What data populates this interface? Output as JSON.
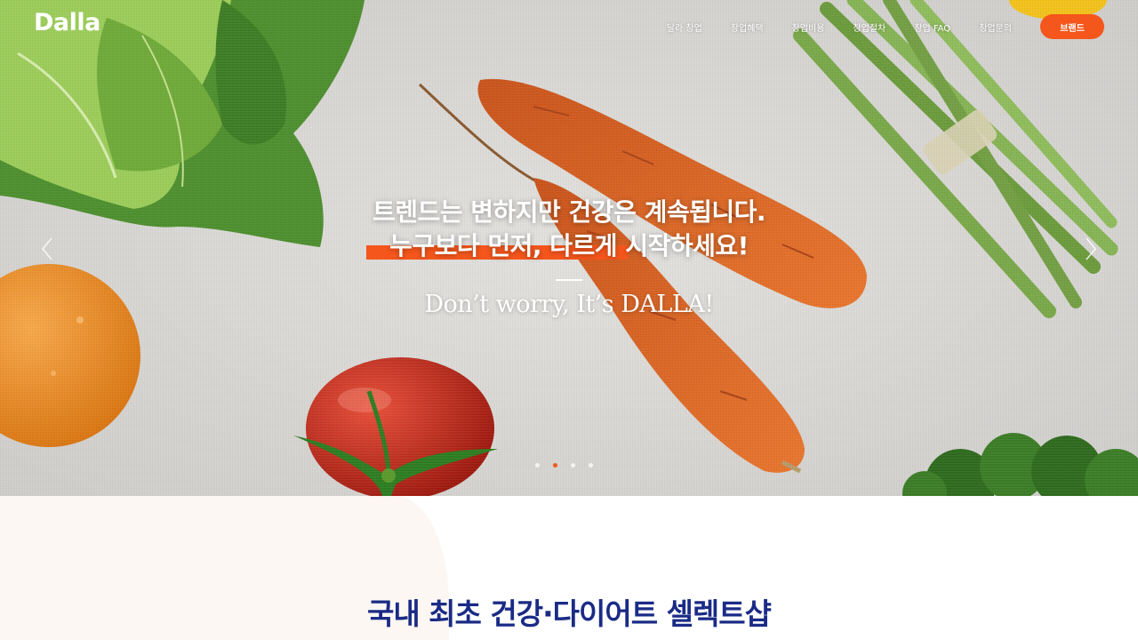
{
  "header": {
    "logo": "Dalla",
    "nav": [
      "달라 창업",
      "창업혜택",
      "창업비용",
      "창업절차",
      "창업 FAQ",
      "창업문의"
    ],
    "cta": "브랜드"
  },
  "hero": {
    "line1": "트렌드는 변하지만 건강은 계속됩니다.",
    "line2": "누구보다 먼저, 다르게 시작하세요!",
    "tagline": "Don’t worry, It’s DALLA!",
    "active_slide": 2,
    "slide_count": 4,
    "prev_icon": "chevron-left-icon",
    "next_icon": "chevron-right-icon"
  },
  "section": {
    "title": "국내 최초 건강·다이어트 셀렉트샵"
  },
  "colors": {
    "accent": "#f4561c",
    "title_navy": "#1a2b86",
    "hero_bg": "#dcdbd8"
  }
}
